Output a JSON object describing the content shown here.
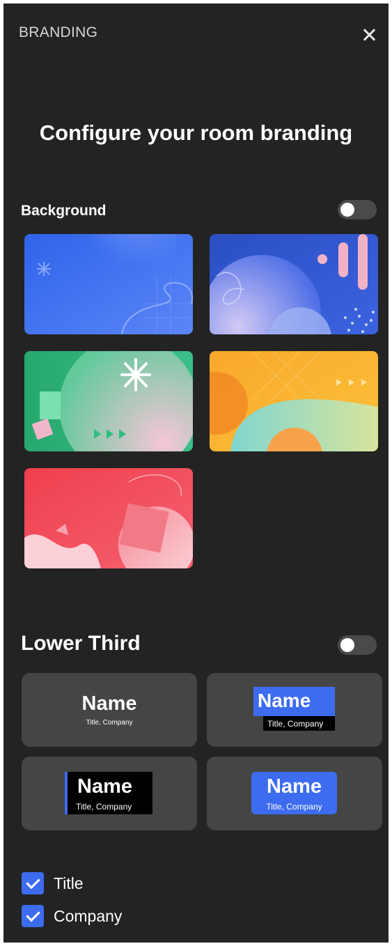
{
  "header": {
    "title": "BRANDING"
  },
  "main": {
    "heading": "Configure your room branding"
  },
  "background": {
    "label": "Background",
    "enabled": false,
    "options": [
      {
        "theme": "blue"
      },
      {
        "theme": "blue-purple"
      },
      {
        "theme": "green"
      },
      {
        "theme": "yellow"
      },
      {
        "theme": "red"
      }
    ]
  },
  "lower_third": {
    "label": "Lower Third",
    "enabled": false,
    "styles": [
      {
        "name": "Name",
        "subtitle": "Title, Company"
      },
      {
        "name": "Name",
        "subtitle": "Title, Company"
      },
      {
        "name": "Name",
        "subtitle": "Title, Company"
      },
      {
        "name": "Name",
        "subtitle": "Title, Company"
      }
    ]
  },
  "options": {
    "title_label": "Title",
    "title_checked": true,
    "company_label": "Company",
    "company_checked": true
  },
  "colors": {
    "panel_bg": "#232323",
    "card_bg": "#454545",
    "accent": "#3d6cf0",
    "toggle_off": "#4a4a4a"
  }
}
